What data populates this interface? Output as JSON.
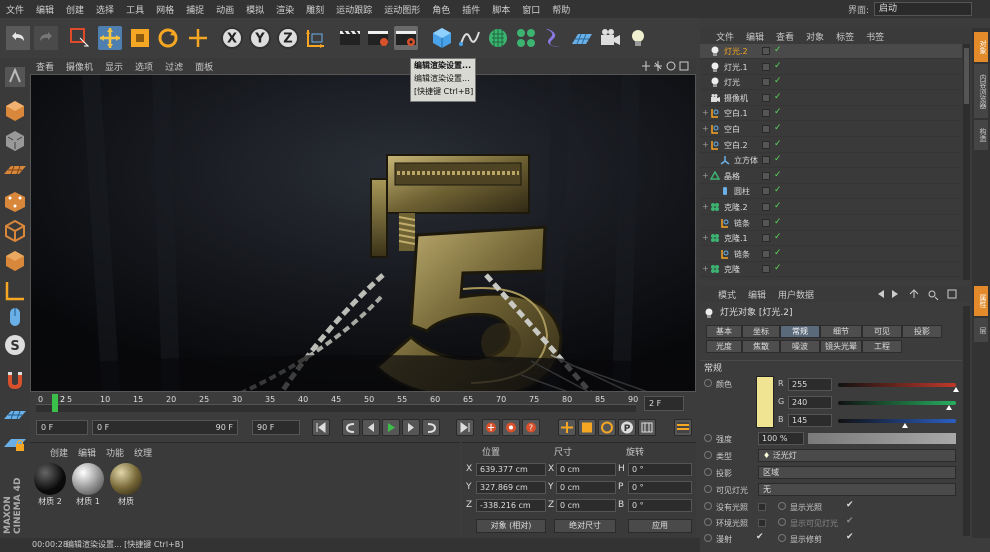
{
  "menubar": {
    "items": [
      "文件",
      "编辑",
      "创建",
      "选择",
      "工具",
      "网格",
      "捕捉",
      "动画",
      "模拟",
      "渲染",
      "雕刻",
      "运动跟踪",
      "运动图形",
      "角色",
      "插件",
      "脚本",
      "窗口",
      "帮助"
    ],
    "layout_label": "界面:",
    "layout_value": "启动"
  },
  "toolbar": {
    "icons": [
      "undo-icon",
      "redo-icon",
      "live-select-icon",
      "move-icon",
      "scale-icon",
      "rotate-icon",
      "model-axis-icon",
      "x-axis-lock-icon",
      "y-axis-lock-icon",
      "z-axis-lock-icon",
      "coordinate-system-icon",
      "render-view-icon",
      "render-picture-viewer-icon",
      "edit-render-settings-icon",
      "cube-icon",
      "spline-pen-icon",
      "subdivision-surface-icon",
      "cloner-icon",
      "deformer-icon",
      "floor-icon",
      "camera-icon",
      "light-icon"
    ],
    "axis_labels": [
      "X",
      "Y",
      "Z"
    ]
  },
  "popup": {
    "items": [
      "编辑渲染设置...",
      "编辑渲染设置...",
      "[快捷键 Ctrl+B]"
    ]
  },
  "viewport": {
    "menu": [
      "查看",
      "摄像机",
      "显示",
      "选项",
      "过滤",
      "面板"
    ]
  },
  "timeline": {
    "ticks": [
      "0",
      "5",
      "10",
      "15",
      "20",
      "25",
      "30",
      "35",
      "40",
      "45",
      "50",
      "55",
      "60",
      "65",
      "70",
      "75",
      "80",
      "85",
      "90"
    ],
    "current_frame_marker": "2",
    "frame_field": "2 F"
  },
  "transport": {
    "start_field": "0 F",
    "min_field": "0 F",
    "max_field": "90 F",
    "end_field": "90 F"
  },
  "materials": {
    "menu": [
      "创建",
      "编辑",
      "功能",
      "纹理"
    ],
    "items": [
      {
        "label": "材质 2",
        "color": "#1a1a1a"
      },
      {
        "label": "材质 1",
        "color": "#bfbfbf"
      },
      {
        "label": "材质",
        "color": "#8a7a4a"
      }
    ]
  },
  "coords": {
    "headers": [
      "位置",
      "尺寸",
      "旋转"
    ],
    "rows": [
      {
        "axis": "X",
        "pos": "639.377 cm",
        "size": "0 cm",
        "rot_axis": "H",
        "rot": "0 °"
      },
      {
        "axis": "Y",
        "pos": "327.869 cm",
        "size": "0 cm",
        "rot_axis": "P",
        "rot": "0 °"
      },
      {
        "axis": "Z",
        "pos": "-338.216 cm",
        "size": "0 cm",
        "rot_axis": "B",
        "rot": "0 °"
      }
    ],
    "mode_dropdown": "对象 (相对)",
    "size_dropdown": "绝对尺寸",
    "apply_button": "应用"
  },
  "status": {
    "time": "00:00:28",
    "message": "编辑渲染设置... [快捷键 Ctrl+B]"
  },
  "object_manager": {
    "menu": [
      "文件",
      "编辑",
      "查看",
      "对象",
      "标签",
      "书签"
    ],
    "objects": [
      {
        "name": "灯光.2",
        "type": "light",
        "indent": 0,
        "selected": true
      },
      {
        "name": "灯光.1",
        "type": "light",
        "indent": 0,
        "selected": false
      },
      {
        "name": "灯光",
        "type": "light",
        "indent": 0,
        "selected": false
      },
      {
        "name": "摄像机",
        "type": "camera",
        "indent": 0,
        "selected": false
      },
      {
        "name": "空白.1",
        "type": "null",
        "indent": 0,
        "selected": false
      },
      {
        "name": "空白",
        "type": "null",
        "indent": 0,
        "selected": false
      },
      {
        "name": "空白.2",
        "type": "null",
        "indent": 0,
        "selected": false
      },
      {
        "name": "立方体",
        "type": "cube",
        "indent": 1,
        "selected": false
      },
      {
        "name": "晶格",
        "type": "lattice",
        "indent": 0,
        "selected": false
      },
      {
        "name": "圆柱",
        "type": "cylinder",
        "indent": 1,
        "selected": false
      },
      {
        "name": "克隆.2",
        "type": "cloner",
        "indent": 0,
        "selected": false
      },
      {
        "name": "链条",
        "type": "null",
        "indent": 1,
        "selected": false
      },
      {
        "name": "克隆.1",
        "type": "cloner",
        "indent": 0,
        "selected": false
      },
      {
        "name": "链条",
        "type": "null",
        "indent": 1,
        "selected": false
      },
      {
        "name": "克隆",
        "type": "cloner",
        "indent": 0,
        "selected": false
      }
    ]
  },
  "attribute_manager": {
    "menu": [
      "模式",
      "编辑",
      "用户数据"
    ],
    "title": "灯光对象 [灯光.2]",
    "tabs_row1": [
      "基本",
      "坐标",
      "常规",
      "细节",
      "可见",
      "投影"
    ],
    "tabs_row2": [
      "光度",
      "焦散",
      "噪波",
      "镜头光晕",
      "工程"
    ],
    "active_tab": "常规",
    "section": "常规",
    "color_label": "颜色",
    "color_swatch": "#f0e391",
    "rgb": [
      {
        "label": "R",
        "value": "255",
        "fraction": 1.0,
        "color": "#c0392b"
      },
      {
        "label": "G",
        "value": "240",
        "fraction": 0.94,
        "color": "#27ae60"
      },
      {
        "label": "B",
        "value": "145",
        "fraction": 0.57,
        "color": "#2c5fc4"
      }
    ],
    "params": [
      {
        "label": "强度",
        "value": "100 %"
      },
      {
        "label": "类型",
        "value": "泛光灯"
      },
      {
        "label": "投影",
        "value": "区域"
      },
      {
        "label": "可见灯光",
        "value": "无"
      }
    ],
    "checks_left": [
      "没有光照",
      "环境光照",
      "漫射"
    ],
    "checks_right": [
      "显示光照",
      "显示可见灯光",
      "显示修剪"
    ]
  },
  "side_tabs": [
    "对象",
    "内容浏览器",
    "构造",
    "属性",
    "层"
  ]
}
